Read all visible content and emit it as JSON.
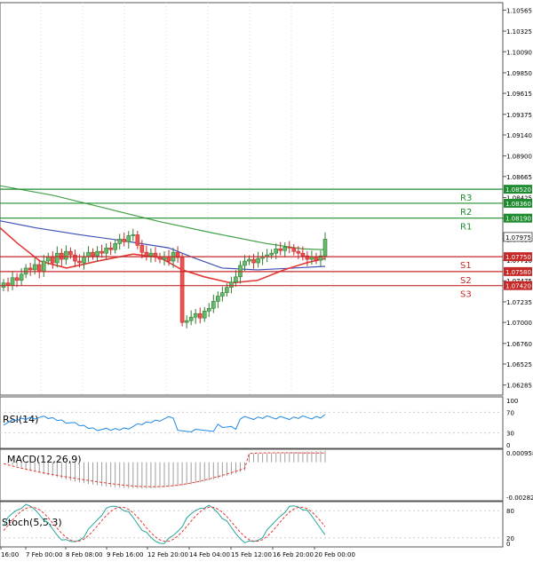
{
  "price_axis": {
    "ticks": [
      "1.10565",
      "1.10325",
      "1.10090",
      "1.09850",
      "1.09615",
      "1.09375",
      "1.09140",
      "1.08900",
      "1.08665",
      "1.08425",
      "1.08190",
      "1.07950",
      "1.07710",
      "1.07475",
      "1.07235",
      "1.07000",
      "1.06760",
      "1.06525",
      "1.06285"
    ],
    "range": [
      1.0617,
      1.1065
    ],
    "current_price": "1.07975"
  },
  "levels": [
    {
      "name": "R3",
      "price": 1.0852,
      "label": "1.08520"
    },
    {
      "name": "R2",
      "price": 1.0836,
      "label": "1.08360"
    },
    {
      "name": "R1",
      "price": 1.0819,
      "label": "1.08190"
    },
    {
      "name": "S1",
      "price": 1.0775,
      "label": "1.07750"
    },
    {
      "name": "S2",
      "price": 1.0758,
      "label": "1.07580"
    },
    {
      "name": "S3",
      "price": 1.0742,
      "label": "1.07420"
    }
  ],
  "time_axis": {
    "labels": [
      "16:00",
      "7 Feb 00:00",
      "8 Feb 08:00",
      "9 Feb 16:00",
      "12 Feb 20:00",
      "14 Feb 04:00",
      "15 Feb 12:00",
      "16 Feb 20:00",
      "20 Feb 00:00"
    ]
  },
  "rsi": {
    "title": "RSI(14)",
    "ticks": [
      "100",
      "70",
      "30",
      "0"
    ]
  },
  "macd": {
    "title": "MACD(12,26,9)",
    "ticks": [
      "0.000958",
      "-0.002822"
    ]
  },
  "stoch": {
    "title": "Stoch(5,5,3)",
    "ticks": [
      "80",
      "20",
      "0"
    ]
  },
  "colors": {
    "bull": "#2e7d32",
    "bear": "#c62828",
    "level_line": "#1e8c2e",
    "level_label_bg": "#1e8c2e",
    "sma_red": "#e53935",
    "ma_blue": "#3f51b5",
    "ma_green": "#43a047",
    "rsi_line": "#1e88e5",
    "current_bg": "#ffffff"
  }
}
